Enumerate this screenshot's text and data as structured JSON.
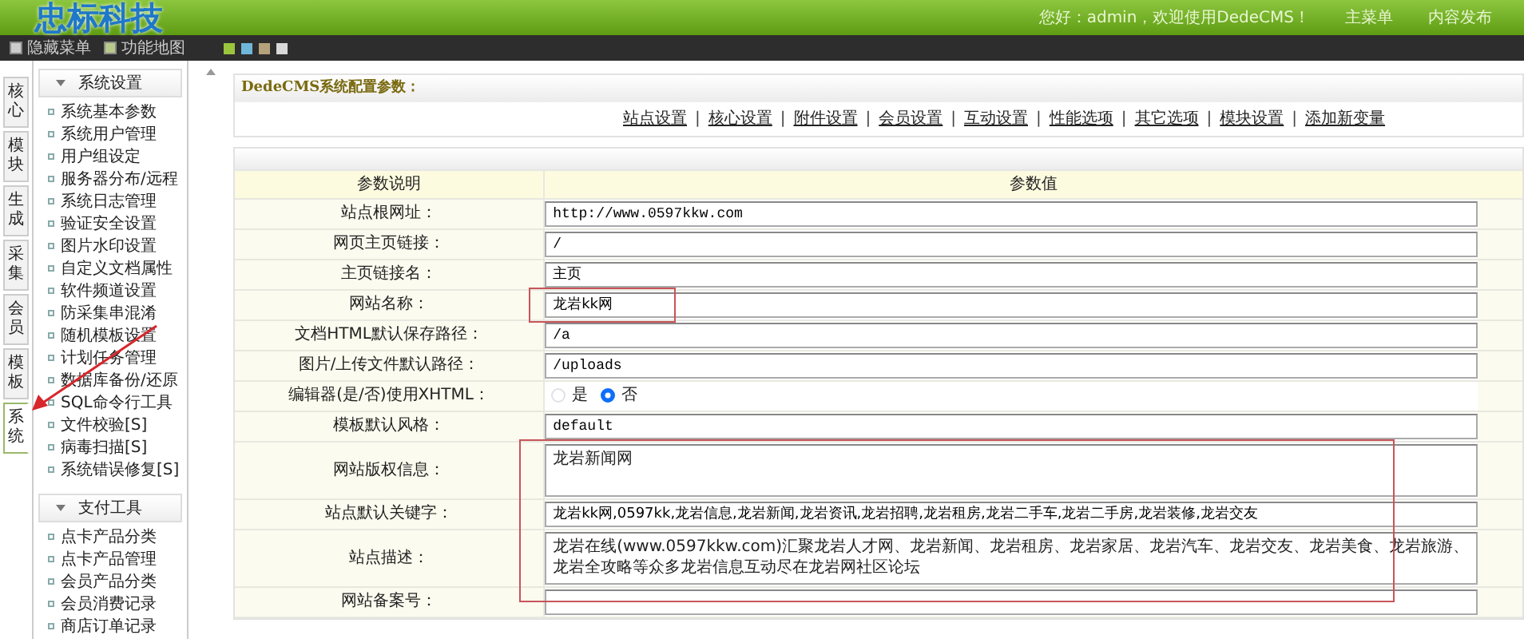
{
  "header": {
    "logo": "忠标科技",
    "greeting": "您好：admin，欢迎使用DedeCMS！",
    "links": [
      "主菜单",
      "内容发布"
    ]
  },
  "toolbar": {
    "buttons": [
      "隐藏菜单",
      "功能地图"
    ],
    "skins": [
      {
        "color": "#9bc53d"
      },
      {
        "color": "#6fb7d9"
      },
      {
        "color": "#b5a27a"
      },
      {
        "color": "#d8d8d8"
      }
    ]
  },
  "side_tabs": [
    {
      "label": "核心",
      "selected": false
    },
    {
      "label": "模块",
      "selected": false
    },
    {
      "label": "生成",
      "selected": false
    },
    {
      "label": "采集",
      "selected": false
    },
    {
      "label": "会员",
      "selected": false
    },
    {
      "label": "模板",
      "selected": false
    },
    {
      "label": "系统",
      "selected": true
    }
  ],
  "sidebar": [
    {
      "title": "系统设置",
      "expanded": true,
      "items": [
        "系统基本参数",
        "系统用户管理",
        "用户组设定",
        "服务器分布/远程",
        "系统日志管理",
        "验证安全设置",
        "图片水印设置",
        "自定义文档属性",
        "软件频道设置",
        "防采集串混淆",
        "随机模板设置",
        "计划任务管理",
        "数据库备份/还原",
        "SQL命令行工具",
        "文件校验[S]",
        "病毒扫描[S]",
        "系统错误修复[S]"
      ]
    },
    {
      "title": "支付工具",
      "expanded": true,
      "items": [
        "点卡产品分类",
        "点卡产品管理",
        "会员产品分类",
        "会员消费记录",
        "商店订单记录"
      ]
    }
  ],
  "config": {
    "title": "DedeCMS系统配置参数：",
    "separator": "|",
    "tabs": [
      "站点设置",
      "核心设置",
      "附件设置",
      "会员设置",
      "互动设置",
      "性能选项",
      "其它选项",
      "模块设置",
      "添加新变量"
    ]
  },
  "table": {
    "columns": [
      "参数说明",
      "参数值"
    ],
    "rows": [
      {
        "label": "站点根网址：",
        "kind": "text",
        "value": "http://www.0597kkw.com",
        "framed": false
      },
      {
        "label": "网页主页链接：",
        "kind": "text",
        "value": "/",
        "framed": false
      },
      {
        "label": "主页链接名：",
        "kind": "text",
        "value": "主页",
        "framed": false
      },
      {
        "label": "网站名称：",
        "kind": "text",
        "value": "龙岩kk网",
        "framed": true
      },
      {
        "label": "文档HTML默认保存路径：",
        "kind": "text",
        "value": "/a",
        "framed": false
      },
      {
        "label": "图片/上传文件默认路径：",
        "kind": "text",
        "value": "/uploads",
        "framed": false
      },
      {
        "label": "编辑器(是/否)使用XHTML：",
        "kind": "radio",
        "options": [
          {
            "label": "是",
            "selected": false
          },
          {
            "label": "否",
            "selected": true
          }
        ],
        "framed": false
      },
      {
        "label": "模板默认风格：",
        "kind": "text",
        "value": "default",
        "framed": false
      },
      {
        "label": "网站版权信息：",
        "kind": "textarea",
        "value": "龙岩新闻网",
        "framed": true
      },
      {
        "label": "站点默认关键字：",
        "kind": "text",
        "value": "龙岩kk网,0597kk,龙岩信息,龙岩新闻,龙岩资讯,龙岩招聘,龙岩租房,龙岩二手车,龙岩二手房,龙岩装修,龙岩交友",
        "framed": true
      },
      {
        "label": "站点描述：",
        "kind": "textarea",
        "value": "龙岩在线(www.0597kkw.com)汇聚龙岩人才网、龙岩新闻、龙岩租房、龙岩家居、龙岩汽车、龙岩交友、龙岩美食、龙岩旅游、龙岩全攻略等众多龙岩信息互动尽在龙岩网社区论坛",
        "framed": true
      },
      {
        "label": "网站备案号：",
        "kind": "text",
        "value": "",
        "framed": false
      }
    ]
  }
}
